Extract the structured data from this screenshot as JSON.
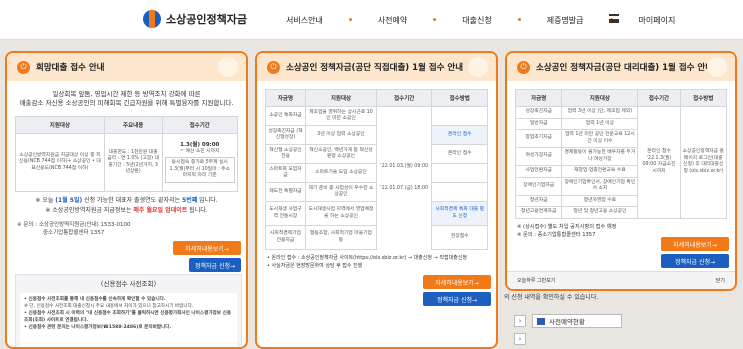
{
  "header": {
    "logo_text": "소상공인정책자금",
    "nav": [
      "서비스안내",
      "사전예약",
      "대출신청",
      "제증명발급",
      "마이페이지"
    ]
  },
  "popup1": {
    "title": "희망대출 접수 안내",
    "intro_line1": "일상회복 앞둠, 영업시간 제한 등 방역조치 강화에 따른",
    "intro_line2": "매출감소 저신용 소상공인의 피해회복 긴급자원을 위해 특별융자를 지원합니다.",
    "table_headers": [
      "지원대상",
      "주요내용",
      "접수기간"
    ],
    "row_target": "소상공인방역지원금 지급대상 이상 중 저신용(NCB 744점 이하)+ 소상공인 • 대표신용도(NCB 744점 이하)",
    "row_content": "대출한도 : 1천만원 대출금리 : 연 1.0% (고정) 대출기간 : 5년(2년거치, 3년상환)",
    "row_period_top": "1.3(월) 09:00",
    "row_period_mid": "~ 예산 소진 시까지",
    "row_period_bot": "동시접속 증가로 5부제 실시 1.3(월)부터 시 10일마 : 주소 마지막 자리 기준",
    "notice_prefix": "※ 오늘",
    "notice_date": "(1월 5일)",
    "notice_mid": "신청 가능한 대표자 출생연도 끝자리는",
    "notice_num": "5번쨰",
    "notice_end": "입니다.",
    "notice2_prefix": "※ 소상공인방역지원금 지급정보는",
    "notice2_red": "매주 월요일 업데이트",
    "notice2_end": "됩니다.",
    "contact1": "※ 문의 : 소상공인방역지원금(안내) 1533-0100",
    "contact2": "중소기업통합콜센터 1357",
    "btn_detail": "자세히내용보기→",
    "btn_apply": "정책자금 신청→",
    "subbox_title": "〈신용점수 사전조회〉",
    "sub1": "• 신용점수 사전조회를 통해 내 신용점수를 신속하게 확인할 수 있습니다.",
    "sub2": "※ 단, 신용점수 사전조회 대출신청시 주요 내용에서 차이가 있으니 참고하시기 바랍니다.",
    "sub3": "• 신용점수 사전조회 시 이력의 \"내 신용점수 조회하기\"를 클릭하시면 신용평가회사인 나이스평가정보 신용조회(조회) 사이트로 연결됩니다.",
    "sub4": "• 신용점수 관련 문의는 나이스평가정보(☎1588-2486)로 문의바랍니다."
  },
  "popup2": {
    "title": "소상공인 정책자금(공단 직접대출) 1월 접수 안내",
    "table_headers": [
      "자금명",
      "지원대상",
      "접수기간",
      "접수방법"
    ],
    "rows": [
      [
        "소공인 특화자금",
        "제조업을 영위하는 상시근로 10인 미만 소공인",
        "",
        ""
      ],
      [
        "성장촉진자금 (혁신형성장)",
        "3년 이상 업력 소상공인",
        "",
        "온라인 접수"
      ],
      [
        "혁신형 소상공인전용",
        "혁신소공인, 백년가게 등 혁신성 판정 소상공인",
        "'22.01.03.(월) 09:00",
        "온라인 접수"
      ],
      [
        "스마트화 도입자금",
        "스마트기술 도입 소상공인",
        "'22.01.07.(금) 18:00",
        ""
      ],
      [
        "재도전 특별자금",
        "재기 준비 중 사업성이 우수한 소상공인",
        "",
        ""
      ],
      [
        "도시재생 사업구역 전통시장",
        "도시재생사업 지역에서 영업예정을 하는 소상공인",
        "",
        "사회적경제 특화 대출 별도 신청"
      ],
      [
        "사회적경제기업 전용자금",
        "협동조합, 사회적기업 마을기업 등",
        "",
        "현장접수"
      ]
    ],
    "foot1": "• 온라인 접수 : 소상공인정책자금 사이트(https://ols.sbiz.or.kr) → 대출신청 → 직접대출신청",
    "foot2": "• 사실자금은 현장방문하여 상담 후 접수 진행",
    "btn_detail": "자세히내용보기→",
    "btn_apply": "정책자금 신청→"
  },
  "popup3": {
    "title": "소상공인 정책자금(공단 대리대출) 1월 접수 안내",
    "table_headers": [
      "자금명",
      "지원대상",
      "접수기간",
      "접수방법"
    ],
    "rows": [
      [
        "성장촉진자금",
        "업력 3년 이상 (단, 제조업 제외)",
        "",
        ""
      ],
      [
        "일반자금",
        "업력 1년 이상",
        "",
        ""
      ],
      [
        "창업초기자금",
        "업력 1년 미만 공단 전문교육 12시간 이상 이수",
        "",
        ""
      ],
      [
        "여성가장자금",
        "경제활동이 불가능한 배우자를 두거나 여성가장",
        "",
        ""
      ],
      [
        "사업전환자금",
        "재창업·업종전환교육 수료",
        "",
        ""
      ],
      [
        "장애인기업자금",
        "장애인기업확인서, 장애인기업 확인서 소지",
        "",
        ""
      ],
      [
        "청년자금",
        "청년자영업 수료",
        "",
        ""
      ],
      [
        "청년고용연계자금",
        "청년 및 청년고용 소상공인",
        "",
        ""
      ]
    ],
    "period_text": "온라인 접수 '22.1.3(월) 09:00 자금소진시까지",
    "method_text": "소상공인정책자금 홈페이지 로그인(대출신청) 후 대리대출신청 (ols.sbiz.or.kr)",
    "note1": "※ (상시접수) 별도 차입 공지사항의 접수 예정",
    "note2": "※ 문의 : 중소기업통합콜센터 1357",
    "btn_detail": "자세히내용보기→",
    "btn_apply": "정책자금 신청→",
    "bottom_left": "오늘하루 그만보기",
    "bottom_right": "닫기"
  },
  "background": {
    "text": "의 신청 내역을 확인하실 수 있습니다.",
    "link1": "사전예약현황"
  }
}
